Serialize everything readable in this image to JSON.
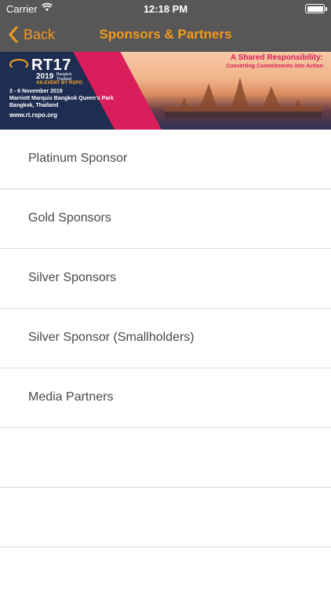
{
  "status_bar": {
    "carrier": "Carrier",
    "time": "12:18 PM",
    "icons": [
      "wifi-icon",
      "battery-icon"
    ]
  },
  "nav": {
    "back_label": "Back",
    "title": "Sponsors & Partners",
    "accent_color": "#f39a1c",
    "bar_color": "#575757"
  },
  "banner": {
    "logo_text": "RT17",
    "year": "2019",
    "city_line1": "Bangkok",
    "city_line2": "Thailand",
    "event_by": "AN EVENT BY RSPO",
    "date_line": "3 - 6 November 2019",
    "venue_line1": "Marriott Marquis Bangkok Queen's Park",
    "venue_line2": "Bangkok, Thailand",
    "url": "www.rt.rspo.org",
    "tagline": "A Shared Responsibility:",
    "tagline_sub": "Converting Commitments into Action"
  },
  "list": {
    "items": [
      {
        "label": "Platinum Sponsor"
      },
      {
        "label": "Gold Sponsors"
      },
      {
        "label": "Silver Sponsors"
      },
      {
        "label": "Silver Sponsor (Smallholders)"
      },
      {
        "label": "Media Partners"
      }
    ]
  }
}
